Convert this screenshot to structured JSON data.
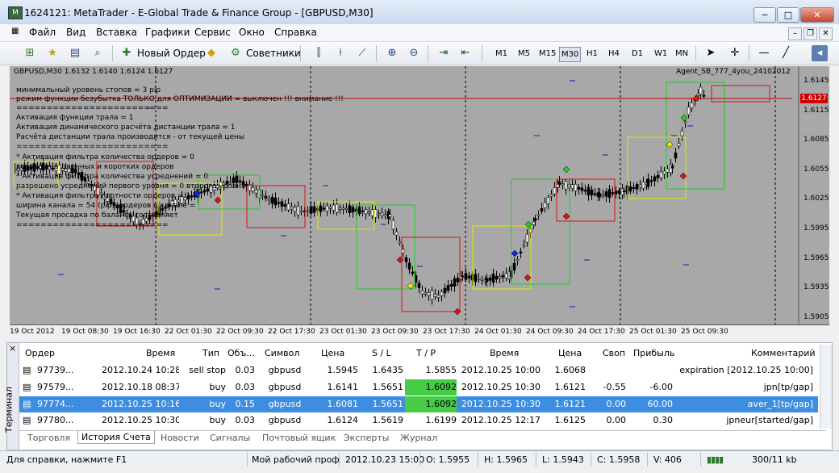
{
  "window": {
    "title": "1624121: MetaTrader - E-Global Trade & Finance Group - [GBPUSD,M30]",
    "minimize": "−",
    "maximize": "□",
    "close": "✕"
  },
  "menu": [
    "Файл",
    "Вид",
    "Вставка",
    "Графики",
    "Сервис",
    "Окно",
    "Справка"
  ],
  "toolbar": {
    "new_order": "Новый Ордер",
    "advisors": "Советники",
    "timeframes": [
      "M1",
      "M5",
      "M15",
      "M30",
      "H1",
      "H4",
      "D1",
      "W1",
      "MN"
    ],
    "active_timeframe": "M30"
  },
  "chart": {
    "symbol_line": "GBPUSD,M30  1.6132 1.6140 1.6124 1.6127",
    "ea_name": "Agent_SB_777_4you_24102012",
    "current_price": "1.6127",
    "price_labels": [
      "1.6145",
      "1.6115",
      "1.6085",
      "1.6055",
      "1.6025",
      "1.5995",
      "1.5965",
      "1.5935",
      "1.5905"
    ],
    "time_labels": [
      "19 Oct 2012",
      "19 Oct 08:30",
      "19 Oct 16:30",
      "22 Oct 01:30",
      "22 Oct 09:30",
      "22 Oct 17:30",
      "23 Oct 01:30",
      "23 Oct 09:30",
      "23 Oct 17:30",
      "24 Oct 01:30",
      "24 Oct 09:30",
      "24 Oct 17:30",
      "25 Oct 01:30",
      "25 Oct 09:30"
    ],
    "overlay_lines": [
      "минимальный уровень стопов =  3  pip",
      "режим функции безубытка ТОЛЬКО для ОПТИМИЗАЦИИ =  выключен  !!! внимание !!!",
      "=========================",
      "Активация функции трала =  1",
      "Активация динамического расчёта дистанции трала =  1",
      "Расчёта дистанции трала производится - от текущей цены",
      "=========================",
      "* Активация фильтра количества ордеров =  0",
      "разрешено длинных и коротких ордеров",
      "* Активация фильтра количества усреднений =  0",
      "разрешено усреднений первого уровня = 0 второго уровня",
      "* Активация фильтра плотности ордеров =  1",
      "ширина канала = 54 (pip), ордеров в канале = ",
      "Текущая просадка по балансу составляет",
      "========================="
    ],
    "accent_colors": {
      "bull_box": "#22cc22",
      "bear_box": "#dd1111",
      "flat_box": "#e6e600",
      "price_line": "#cc0000",
      "period_sep": "#000000"
    }
  },
  "terminal": {
    "side_label": "Терминал",
    "close": "×",
    "columns": [
      "Ордер",
      "Время",
      "Тип",
      "Объ...",
      "Символ",
      "Цена",
      "S / L",
      "T / P",
      "Время",
      "Цена",
      "Своп",
      "Прибыль",
      "Комментарий"
    ],
    "rows": [
      {
        "order": "97739...",
        "time": "2012.10.24 10:28",
        "type": "sell stop",
        "volume": "0.03",
        "symbol": "gbpusd",
        "price": "1.5945",
        "sl": "1.6435",
        "tp": "1.5855",
        "close_time": "2012.10.25 10:00",
        "close_price": "1.6068",
        "swap": "",
        "profit": "",
        "comment": "expiration [2012.10.25 10:00]"
      },
      {
        "order": "97579...",
        "time": "2012.10.18 08:37",
        "type": "buy",
        "volume": "0.03",
        "symbol": "gbpusd",
        "price": "1.6141",
        "sl": "1.5651",
        "tp": "1.6092",
        "close_time": "2012.10.25 10:30",
        "close_price": "1.6121",
        "swap": "-0.55",
        "profit": "-6.00",
        "comment": "jpn[tp/gap]"
      },
      {
        "order": "97774...",
        "time": "2012.10.25 10:16",
        "type": "buy",
        "volume": "0.15",
        "symbol": "gbpusd",
        "price": "1.6081",
        "sl": "1.5651",
        "tp": "1.6092",
        "close_time": "2012.10.25 10:30",
        "close_price": "1.6121",
        "swap": "0.00",
        "profit": "60.00",
        "comment": "aver_1[tp/gap]"
      },
      {
        "order": "97780...",
        "time": "2012.10.25 10:30",
        "type": "buy",
        "volume": "0.03",
        "symbol": "gbpusd",
        "price": "1.6124",
        "sl": "1.5619",
        "tp": "1.6199",
        "close_time": "2012.10.25 12:17",
        "close_price": "1.6125",
        "swap": "0.00",
        "profit": "0.30",
        "comment": "jpneur[started/gap]"
      }
    ],
    "tabs": [
      "Торговля",
      "История Счета",
      "Новости",
      "Сигналы",
      "Почтовый ящик",
      "Эксперты",
      "Журнал"
    ],
    "active_tab": "История Счета"
  },
  "status": {
    "help": "Для справки, нажмите F1",
    "profile": "Мой рабочий проф",
    "datetime": "2012.10.23 15:00",
    "open": "O: 1.5955",
    "high": "H: 1.5965",
    "low": "L: 1.5943",
    "close": "C: 1.5958",
    "volume": "V: 406",
    "traffic": "300/11 kb"
  }
}
